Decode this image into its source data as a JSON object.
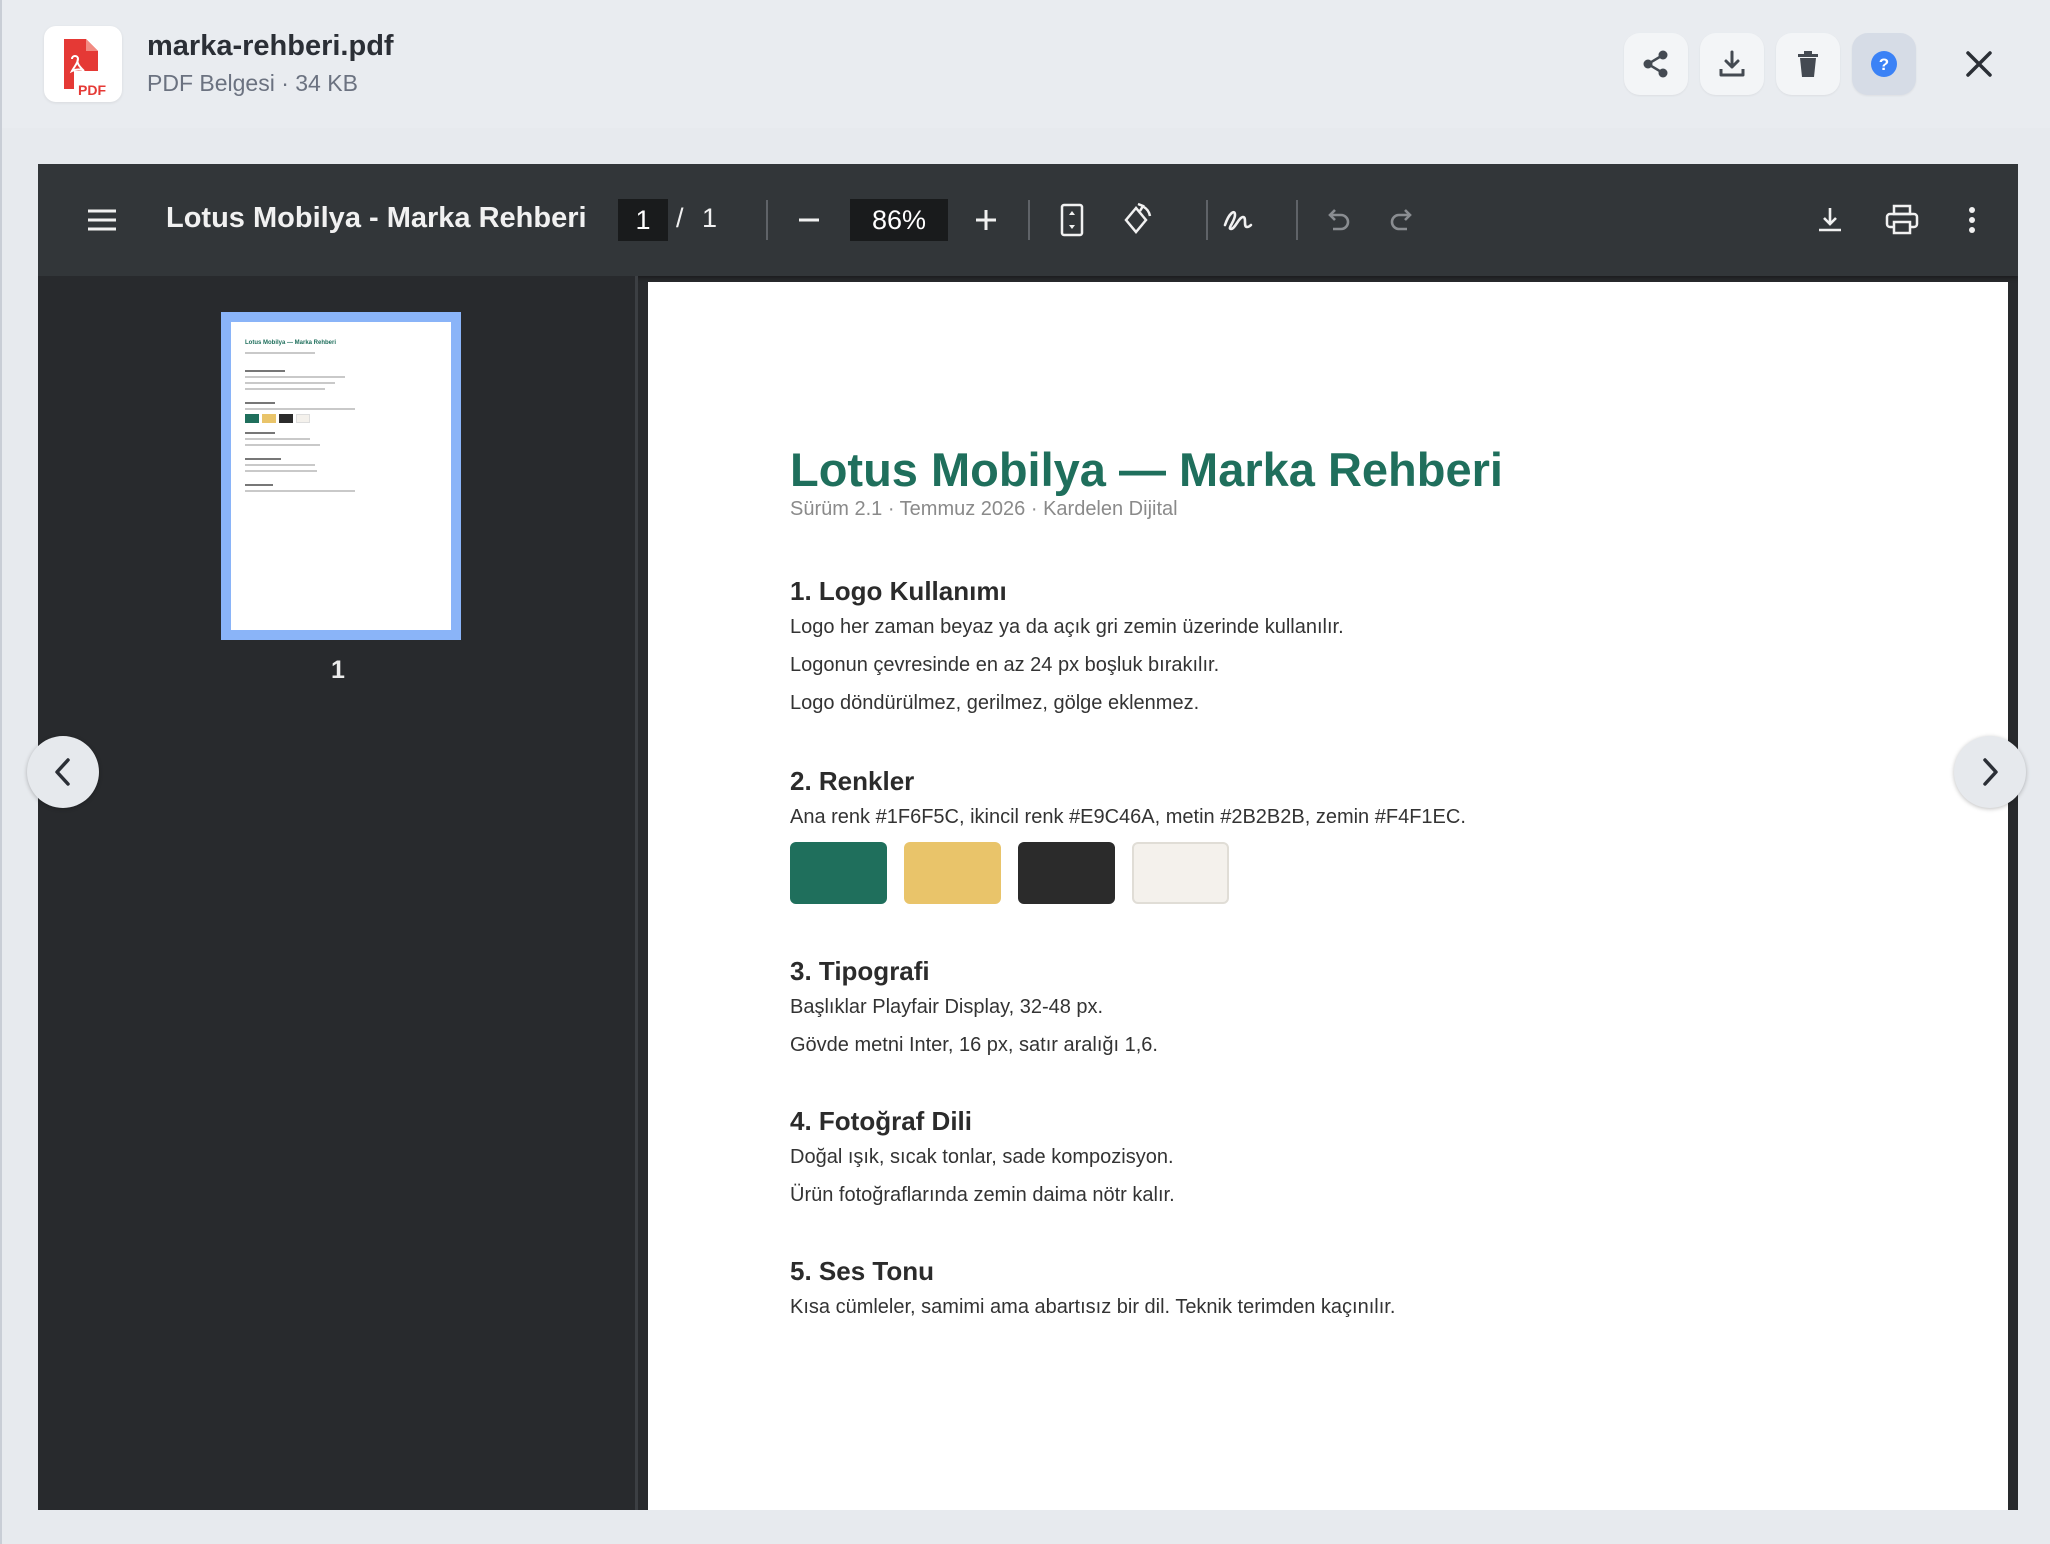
{
  "header": {
    "file_name": "marka-rehberi.pdf",
    "file_meta": "PDF Belgesi · 34 KB",
    "file_icon_label": "PDF",
    "actions": [
      "share-icon",
      "download-icon",
      "trash-icon",
      "help-icon"
    ],
    "close_icon": "close-icon"
  },
  "toolbar": {
    "title": "Lotus Mobilya - Marka Rehberi",
    "current_page": "1",
    "page_separator": "/",
    "total_pages": "1",
    "zoom": "86%"
  },
  "sidebar": {
    "thumb_label": "1",
    "thumb_title": "Lotus Mobilya — Marka Rehberi"
  },
  "document": {
    "title": "Lotus Mobilya — Marka Rehberi",
    "subtitle": "Sürüm 2.1 · Temmuz 2026 · Kardelen Dijital",
    "sections": [
      {
        "heading": "1. Logo Kullanımı",
        "lines": [
          "Logo her zaman beyaz ya da açık gri zemin üzerinde kullanılır.",
          "Logonun çevresinde en az 24 px boşluk bırakılır.",
          "Logo döndürülmez, gerilmez, gölge eklenmez."
        ]
      },
      {
        "heading": "2. Renkler",
        "lines": [
          "Ana renk #1F6F5C, ikincil renk #E9C46A, metin #2B2B2B, zemin #F4F1EC."
        ]
      },
      {
        "heading": "3. Tipografi",
        "lines": [
          "Başlıklar Playfair Display, 32-48 px.",
          "Gövde metni Inter, 16 px, satır aralığı 1,6."
        ]
      },
      {
        "heading": "4. Fotoğraf Dili",
        "lines": [
          "Doğal ışık, sıcak tonlar, sade kompozisyon.",
          "Ürün fotoğraflarında zemin daima nötr kalır."
        ]
      },
      {
        "heading": "5. Ses Tonu",
        "lines": [
          "Kısa cümleler, samimi ama abartısız bir dil. Teknik terimden kaçınılır."
        ]
      }
    ],
    "swatches": [
      "#1F6F5C",
      "#E9C46A",
      "#2B2B2B",
      "#F4F1EC"
    ]
  },
  "colors": {
    "accent": "#1F6F5C",
    "thumb_highlight": "#8AB4F8",
    "help_blue": "#3B82F6",
    "pdf_red": "#E53935"
  }
}
